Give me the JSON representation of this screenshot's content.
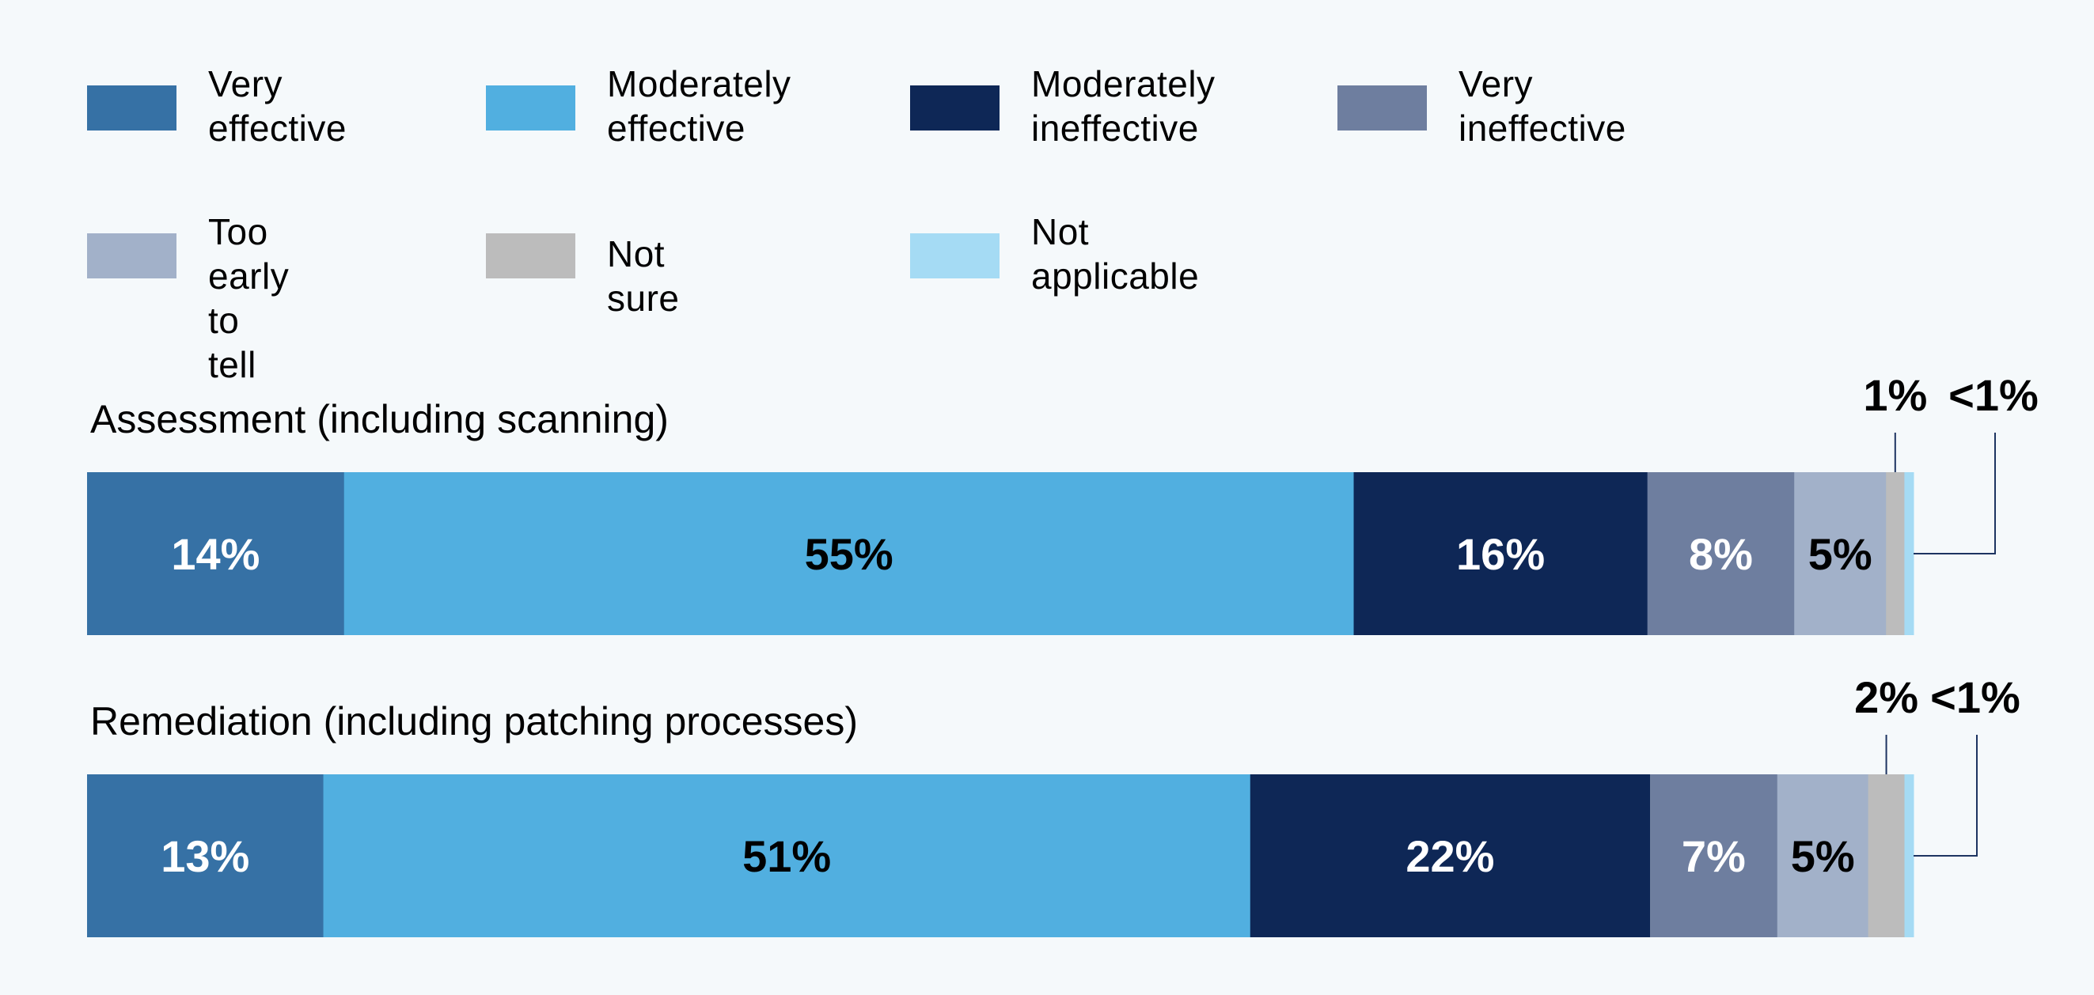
{
  "chart_data": {
    "type": "bar",
    "orientation": "horizontal-stacked",
    "title": "",
    "xlabel": "",
    "ylabel": "",
    "xlim": [
      0,
      100
    ],
    "grid": false,
    "legend_position": "top",
    "legend": [
      {
        "name": "Very effective",
        "label": "Very\neffective",
        "color": "#3671a5"
      },
      {
        "name": "Moderately effective",
        "label": "Moderately\neffective",
        "color": "#51afe0"
      },
      {
        "name": "Moderately ineffective",
        "label": "Moderately\nineffective",
        "color": "#0e2756"
      },
      {
        "name": "Very ineffective",
        "label": "Very\nineffective",
        "color": "#6e7e9f"
      },
      {
        "name": "Too early to tell",
        "label": "Too early\nto tell",
        "color": "#a2b1c9"
      },
      {
        "name": "Not sure",
        "label": "Not sure",
        "color": "#bcbcbc"
      },
      {
        "name": "Not applicable",
        "label": "Not\napplicable",
        "color": "#a5dbf4"
      }
    ],
    "categories": [
      "Assessment (including scanning)",
      "Remediation (including patching processes)"
    ],
    "series": [
      {
        "name": "Very effective",
        "values": [
          14,
          13
        ],
        "labels": [
          "14%",
          "13%"
        ],
        "label_color": "#ffffff"
      },
      {
        "name": "Moderately effective",
        "values": [
          55,
          51
        ],
        "labels": [
          "55%",
          "51%"
        ],
        "label_color": "#000000"
      },
      {
        "name": "Moderately ineffective",
        "values": [
          16,
          22
        ],
        "labels": [
          "16%",
          "22%"
        ],
        "label_color": "#ffffff"
      },
      {
        "name": "Very ineffective",
        "values": [
          8,
          7
        ],
        "labels": [
          "8%",
          "7%"
        ],
        "label_color": "#ffffff"
      },
      {
        "name": "Too early to tell",
        "values": [
          5,
          5
        ],
        "labels": [
          "5%",
          "5%"
        ],
        "label_color": "#000000"
      },
      {
        "name": "Not sure",
        "values": [
          1,
          2
        ],
        "labels": [
          "1%",
          "2%"
        ],
        "label_color": "#000000",
        "callout": true
      },
      {
        "name": "Not applicable",
        "values": [
          0.5,
          0.5
        ],
        "labels": [
          "<1%",
          "<1%"
        ],
        "label_color": "#000000",
        "callout": true
      }
    ],
    "leader_line_color": "#1d3461"
  }
}
